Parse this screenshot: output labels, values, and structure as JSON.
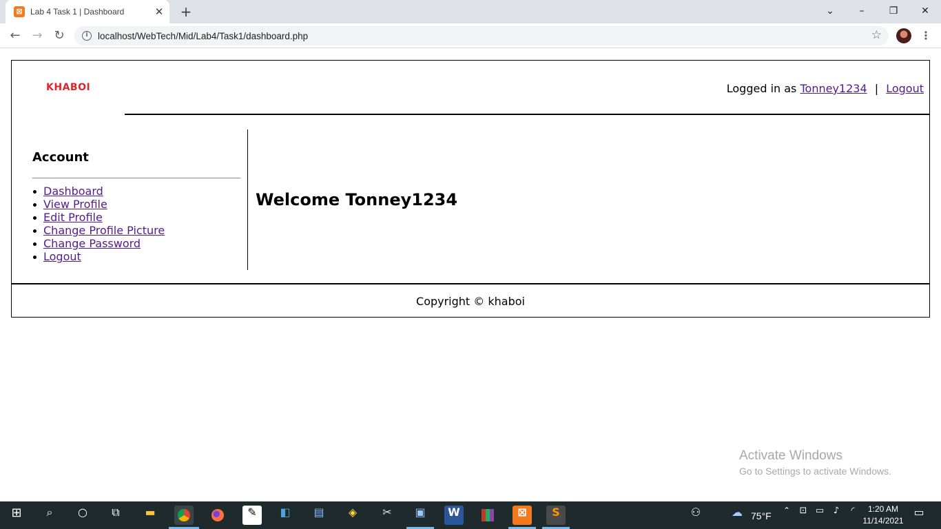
{
  "browser": {
    "tab_title": "Lab 4 Task 1 | Dashboard",
    "tab_favicon": "xampp-icon",
    "url": "localhost/WebTech/Mid/Lab4/Task1/dashboard.php"
  },
  "header": {
    "logo_text": "KHABOI",
    "logged_in_prefix": "Logged in as",
    "username": "Tonney1234",
    "separator": "|",
    "logout_label": "Logout"
  },
  "sidebar": {
    "title": "Account",
    "items": [
      {
        "label": "Dashboard"
      },
      {
        "label": "View Profile"
      },
      {
        "label": "Edit Profile"
      },
      {
        "label": "Change Profile Picture"
      },
      {
        "label": "Change Password"
      },
      {
        "label": "Logout"
      }
    ]
  },
  "main": {
    "welcome": "Welcome Tonney1234"
  },
  "footer": {
    "copyright": "Copyright © khaboi"
  },
  "watermark": {
    "title": "Activate Windows",
    "subtitle": "Go to Settings to activate Windows."
  },
  "taskbar": {
    "weather": "75°F",
    "time": "1:20 AM",
    "date": "11/14/2021"
  },
  "colors": {
    "logo": "#e0242b",
    "link": "#551a8b",
    "taskbar": "#1f2a2d",
    "watermark": "#a8a8a8"
  }
}
